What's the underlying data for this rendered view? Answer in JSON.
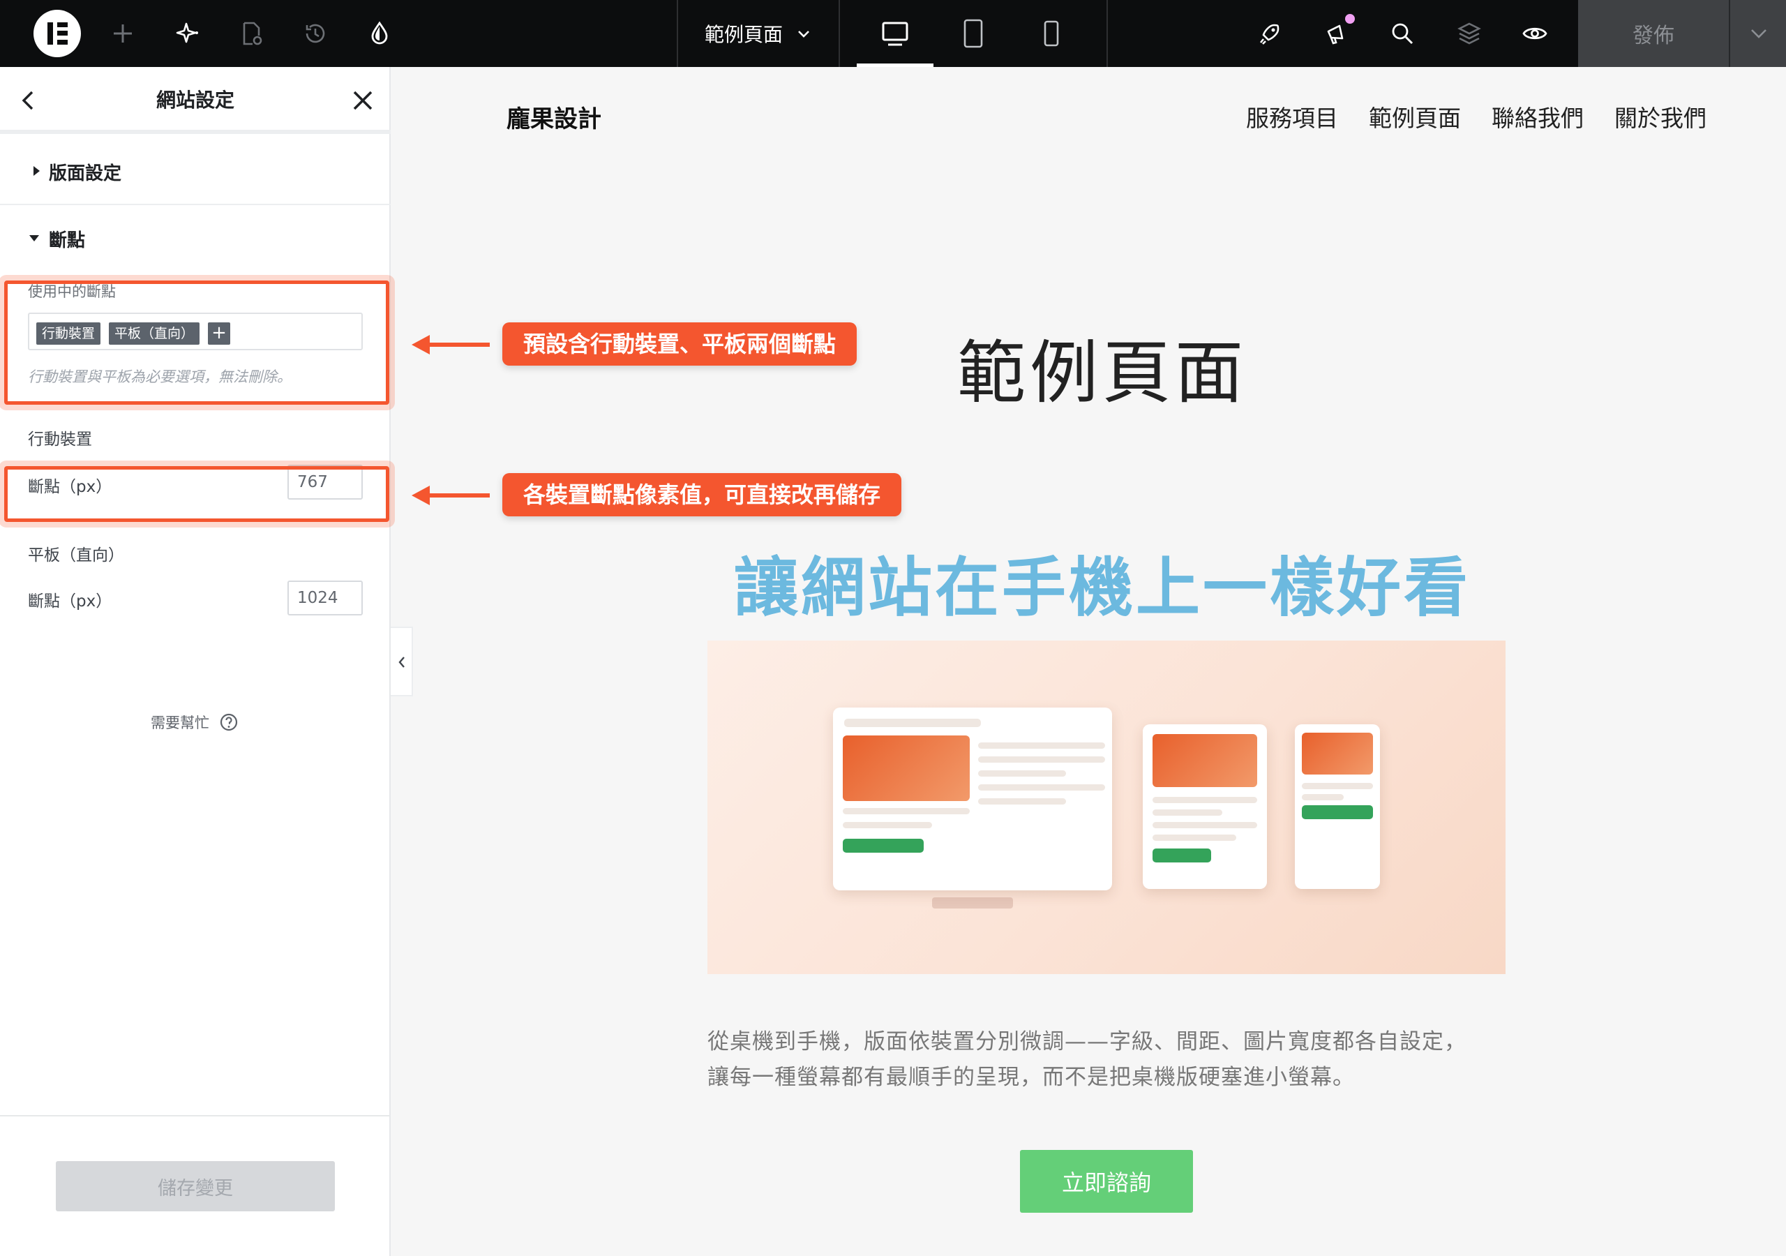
{
  "topbar": {
    "page_selector_label": "範例頁面",
    "publish_label": "發佈",
    "icons": [
      "elementor-logo-icon",
      "add-icon",
      "ai-sparkle-icon",
      "page-settings-icon",
      "history-icon",
      "site-settings-drop-icon",
      "launch-rocket-icon",
      "announcements-icon",
      "search-icon",
      "structure-layers-icon",
      "preview-eye-icon"
    ],
    "devices": [
      "desktop",
      "tablet",
      "mobile"
    ],
    "active_device": "desktop"
  },
  "panel": {
    "title": "網站設定",
    "sections": [
      {
        "label": "版面設定",
        "expanded": false
      },
      {
        "label": "斷點",
        "expanded": true
      }
    ],
    "active_breakpoints": {
      "label": "使用中的斷點",
      "tags": [
        "行動裝置",
        "平板（直向）"
      ],
      "add_label": "+",
      "hint": "行動裝置與平板為必要選項，無法刪除。"
    },
    "mobile": {
      "heading": "行動裝置",
      "field_label": "斷點（px）",
      "value": "767"
    },
    "tablet": {
      "heading": "平板（直向）",
      "field_label": "斷點（px）",
      "value": "1024"
    },
    "help_label": "需要幫忙",
    "save_label": "儲存變更"
  },
  "annotations": {
    "callout_1": "預設含行動裝置、平板兩個斷點",
    "callout_2": "各裝置斷點像素值，可直接改再儲存",
    "accent_color": "#f4562f"
  },
  "site": {
    "logo": "龐果設計",
    "nav": [
      "服務項目",
      "範例頁面",
      "聯絡我們",
      "關於我們"
    ],
    "hero_title": "範例頁面",
    "hero_subtitle": "讓網站在手機上一樣好看",
    "body_line_1": "從桌機到手機，版面依裝置分別微調——字級、間距、圖片寬度都各自設定，",
    "body_line_2": "讓每一種螢幕都有最順手的呈現，而不是把桌機版硬塞進小螢幕。",
    "cta_label": "立即諮詢",
    "colors": {
      "subtitle": "#6cb9df",
      "cta": "#64cf78"
    }
  }
}
